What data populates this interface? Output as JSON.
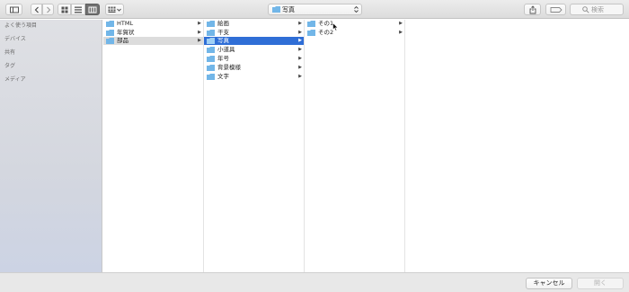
{
  "toolbar": {
    "path_popup_label": "写真",
    "search_placeholder": "検索"
  },
  "sidebar": {
    "sections": [
      "よく使う項目",
      "デバイス",
      "共有",
      "タグ",
      "メディア"
    ]
  },
  "columns": [
    {
      "items": [
        {
          "label": "HTML",
          "state": "normal"
        },
        {
          "label": "年賀状",
          "state": "normal"
        },
        {
          "label": "部品",
          "state": "selected-inactive"
        }
      ]
    },
    {
      "items": [
        {
          "label": "絵画",
          "state": "normal"
        },
        {
          "label": "干支",
          "state": "normal"
        },
        {
          "label": "写真",
          "state": "selected-active"
        },
        {
          "label": "小道具",
          "state": "normal"
        },
        {
          "label": "年号",
          "state": "normal"
        },
        {
          "label": "背景模様",
          "state": "normal"
        },
        {
          "label": "文字",
          "state": "normal"
        }
      ]
    },
    {
      "items": [
        {
          "label": "その1",
          "state": "normal"
        },
        {
          "label": "その2",
          "state": "normal"
        }
      ]
    }
  ],
  "buttons": {
    "cancel": "キャンセル",
    "open": "開く"
  },
  "colors": {
    "folder_blue": "#72b6e8",
    "selection_blue": "#2f6ed6"
  }
}
